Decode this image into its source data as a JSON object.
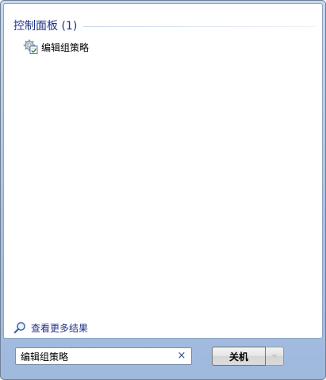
{
  "results": {
    "section_title": "控制面板 (1)",
    "items": [
      {
        "label": "编辑组策略",
        "icon": "group-policy-icon"
      }
    ],
    "see_more_label": "查看更多结果"
  },
  "search": {
    "value": "编辑组策略",
    "clear_label": "×"
  },
  "power": {
    "shutdown_label": "关机",
    "menu_icon": "chevron-down-icon"
  },
  "colors": {
    "section_title": "#1e3287",
    "frame_gradient_top": "#c6d8ee",
    "frame_gradient_bottom": "#9fb9dd"
  }
}
